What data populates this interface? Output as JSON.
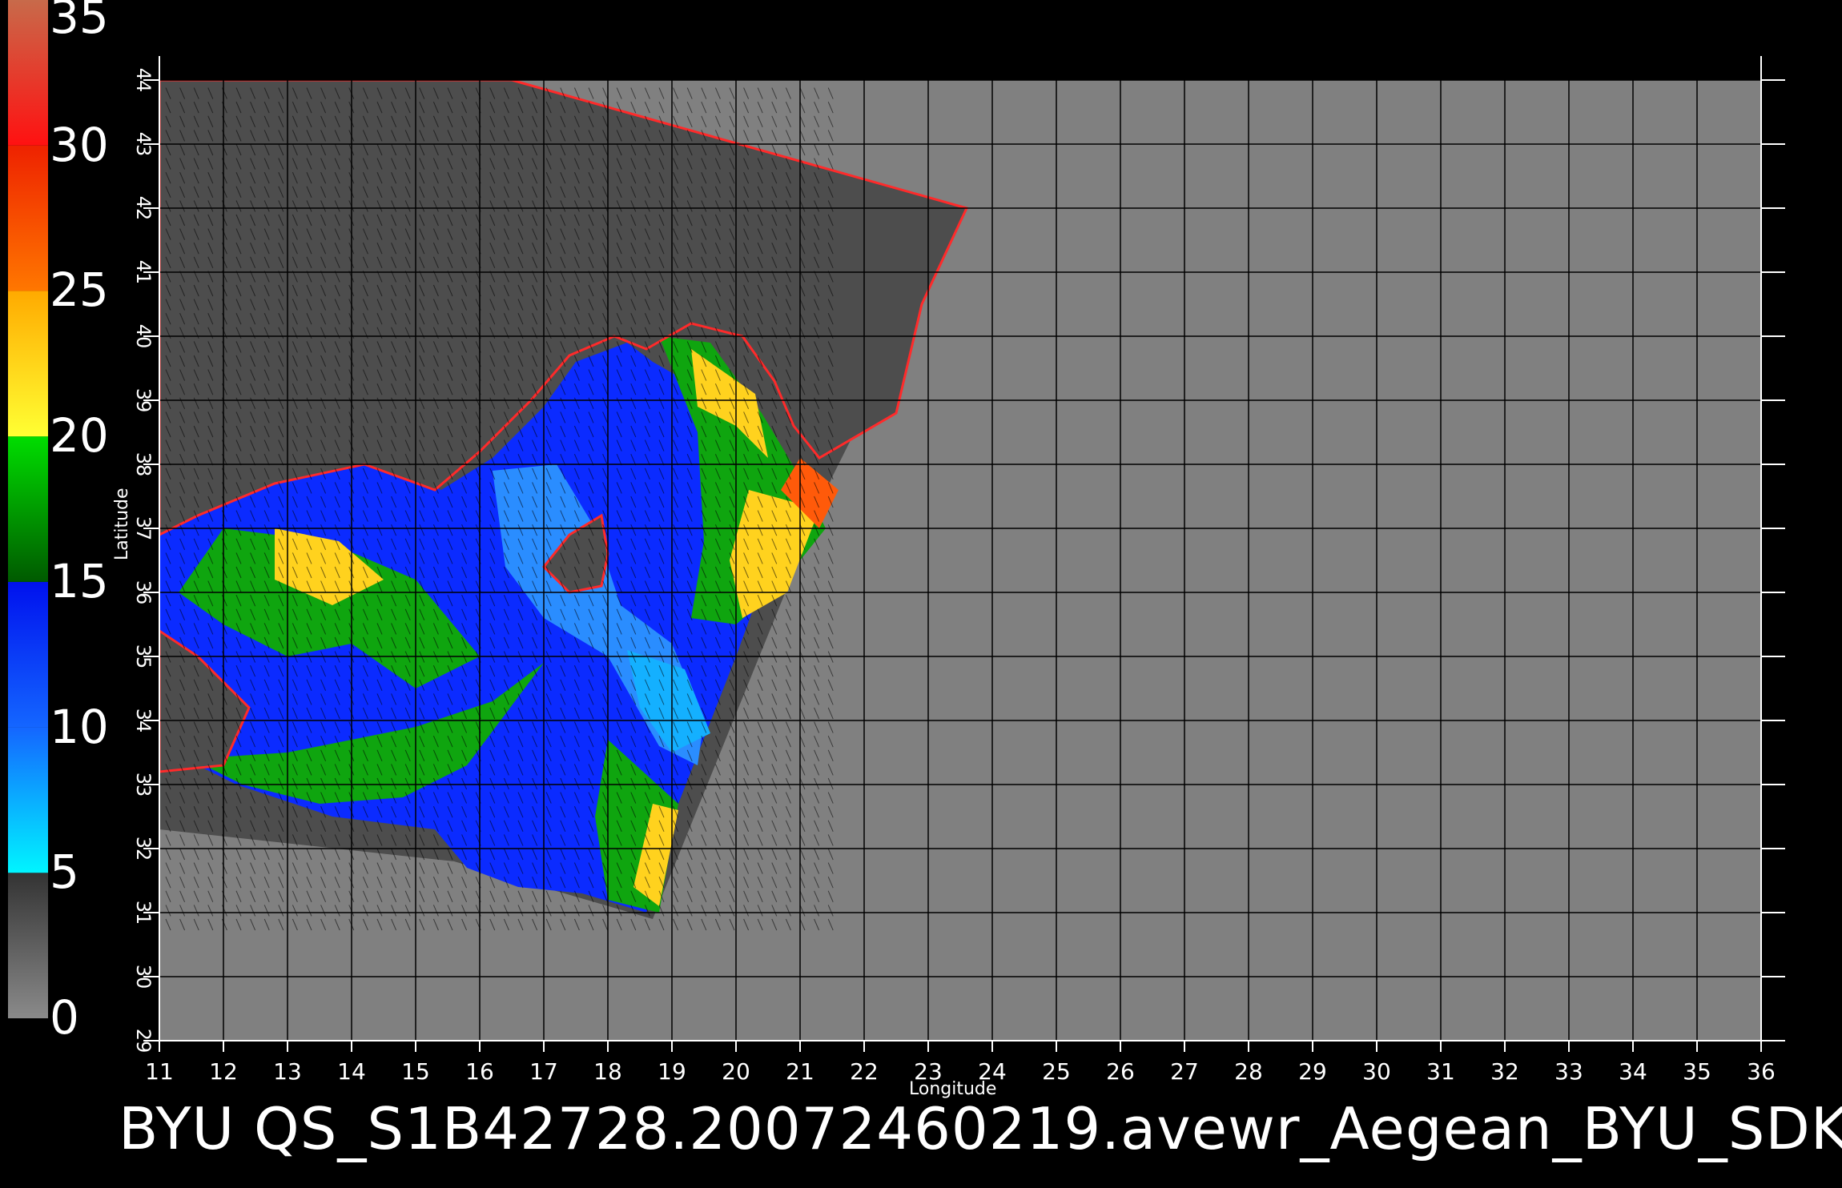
{
  "colorbar": {
    "stops": [
      {
        "from": 0,
        "to": 5,
        "color": "#6e6e6e",
        "gradient": [
          "#8a8a8a",
          "#333333"
        ]
      },
      {
        "from": 5,
        "to": 10,
        "color": "#1a9fff",
        "gradient": [
          "#00f5ff",
          "#1466ff"
        ]
      },
      {
        "from": 10,
        "to": 15,
        "color": "#0a3cff",
        "gradient": [
          "#1466ff",
          "#0011ee"
        ]
      },
      {
        "from": 15,
        "to": 20,
        "color": "#0a9a0a",
        "gradient": [
          "#005a00",
          "#00dd00"
        ]
      },
      {
        "from": 20,
        "to": 25,
        "color": "#ffcc00",
        "gradient": [
          "#ffff33",
          "#ffaa00"
        ]
      },
      {
        "from": 25,
        "to": 30,
        "color": "#ff5500",
        "gradient": [
          "#ff7700",
          "#ee2200"
        ]
      },
      {
        "from": 30,
        "to": 35,
        "color": "#ff1111",
        "gradient": [
          "#ff1111",
          "#c86a4a"
        ]
      }
    ],
    "labels": [
      "35",
      "30",
      "25",
      "20",
      "15",
      "10",
      "5",
      "0"
    ]
  },
  "map": {
    "x_axis_label": "Longitude",
    "y_axis_label": "Latitude",
    "lon_ticks": [
      "11",
      "12",
      "13",
      "14",
      "15",
      "16",
      "17",
      "18",
      "19",
      "20",
      "21",
      "22",
      "23",
      "24",
      "25",
      "26",
      "27",
      "28",
      "29",
      "30",
      "31",
      "32",
      "33",
      "34",
      "35",
      "36"
    ],
    "lat_ticks": [
      "29",
      "30",
      "31",
      "32",
      "33",
      "34",
      "35",
      "36",
      "37",
      "38",
      "39",
      "40",
      "41",
      "42",
      "43",
      "44"
    ],
    "lon_range": [
      11,
      36
    ],
    "lat_range": [
      29,
      44
    ],
    "background_color": "#808080",
    "land_color": "#4d4d4d",
    "grid_color": "#000000"
  },
  "caption": "BYU  QS_S1B42728.20072460219.avewr_Aegean_BYU_SDK"
}
